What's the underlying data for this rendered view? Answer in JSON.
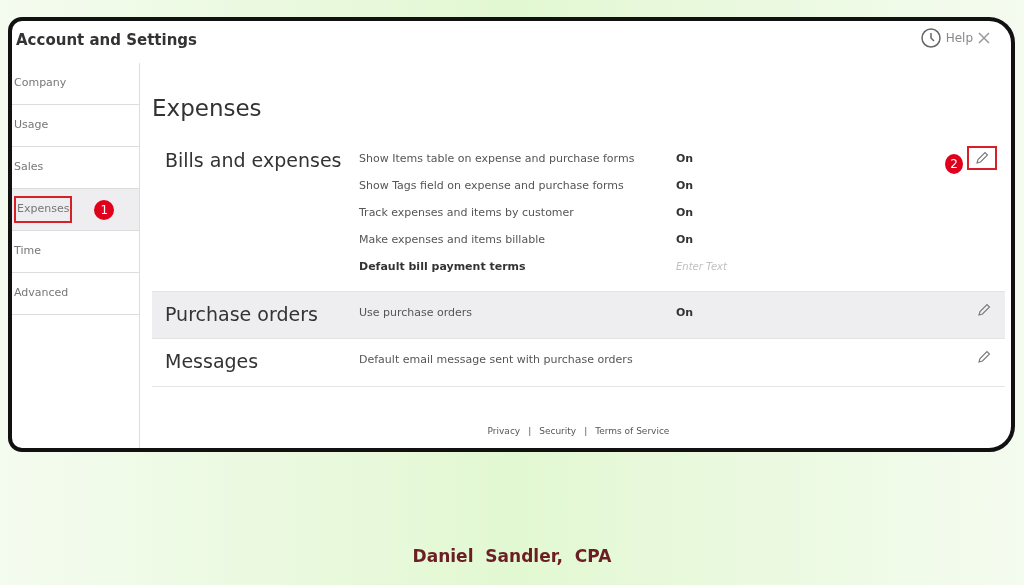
{
  "window": {
    "title": "Account and Settings",
    "help": "Help"
  },
  "sidebar": {
    "items": [
      {
        "label": "Company",
        "selected": false
      },
      {
        "label": "Usage",
        "selected": false
      },
      {
        "label": "Sales",
        "selected": false
      },
      {
        "label": "Expenses",
        "selected": true,
        "callout": "1"
      },
      {
        "label": "Time",
        "selected": false
      },
      {
        "label": "Advanced",
        "selected": false
      }
    ]
  },
  "page_title": "Expenses",
  "sections": [
    {
      "title": "Bills and expenses",
      "selected": false,
      "edit_callout": "2",
      "rows": [
        {
          "kind": "toggle",
          "label": "Show Items table on expense and purchase forms",
          "value": "On"
        },
        {
          "kind": "toggle",
          "label": "Show Tags field on expense and purchase forms",
          "value": "On"
        },
        {
          "kind": "toggle",
          "label": "Track expenses and items by customer",
          "value": "On"
        },
        {
          "kind": "toggle",
          "label": "Make expenses and items billable",
          "value": "On"
        },
        {
          "kind": "field",
          "label": "Default bill payment terms",
          "placeholder": "Enter Text"
        }
      ]
    },
    {
      "title": "Purchase orders",
      "selected": true,
      "rows": [
        {
          "kind": "toggle",
          "label": "Use purchase orders",
          "value": "On"
        }
      ]
    },
    {
      "title": "Messages",
      "selected": false,
      "rows": [
        {
          "kind": "text",
          "label": "Default email message sent with purchase orders"
        }
      ]
    }
  ],
  "footer_links": [
    "Privacy",
    "Security",
    "Terms of Service"
  ],
  "footer_separators": [
    "|",
    "|"
  ],
  "credit": "Daniel  Sandler,  CPA"
}
